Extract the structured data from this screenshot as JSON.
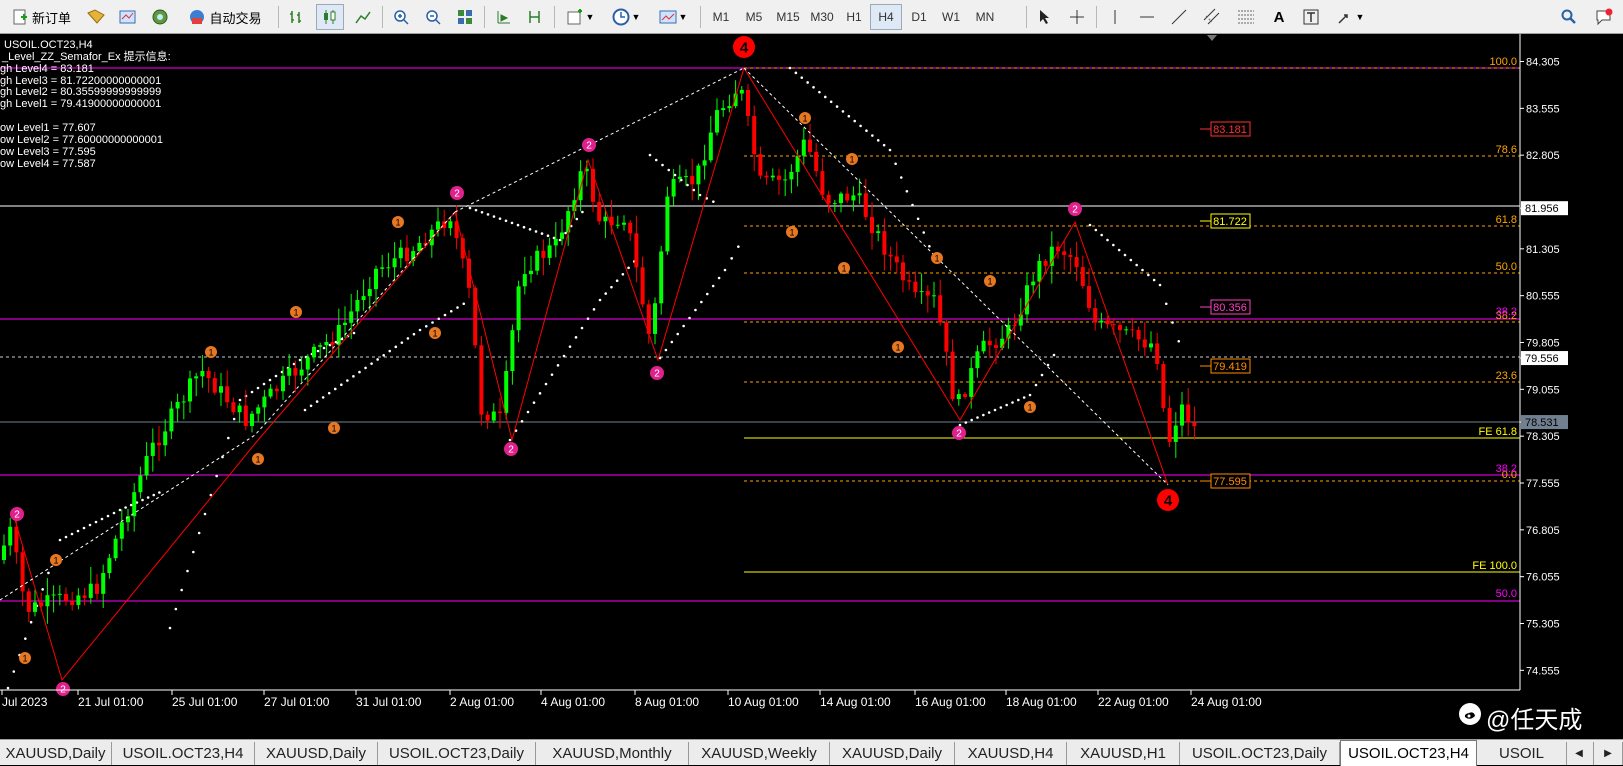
{
  "toolbar": {
    "new_order_label": "新订单",
    "auto_trade_label": "自动交易",
    "timeframes": [
      "M1",
      "M5",
      "M15",
      "M30",
      "H1",
      "H4",
      "D1",
      "W1",
      "MN"
    ],
    "active_timeframe": "H4"
  },
  "chart": {
    "symbol_title": "USOIL.OCT23,H4",
    "indicator_header": "_Level_ZZ_Semafor_Ex 提示信息:",
    "high_levels": [
      "gh Level4 = 83.181",
      "gh Level3 = 81.72200000000001",
      "gh Level2 = 80.35599999999999",
      "gh Level1 = 79.41900000000001"
    ],
    "low_levels": [
      "ow Level1 = 77.607",
      "ow Level2 = 77.60000000000001",
      "ow Level3 = 77.595",
      "ow Level4 = 77.587"
    ],
    "y_axis_ticks": [
      "84.305",
      "83.555",
      "82.805",
      "81.956",
      "81.305",
      "80.555",
      "79.805",
      "79.556",
      "79.055",
      "78.531",
      "78.305",
      "77.555",
      "76.805",
      "76.055",
      "75.305",
      "74.555"
    ],
    "x_axis_ticks": [
      "Jul 2023",
      "21 Jul 01:00",
      "25 Jul 01:00",
      "27 Jul 01:00",
      "31 Jul 01:00",
      "2 Aug 01:00",
      "4 Aug 01:00",
      "8 Aug 01:00",
      "10 Aug 01:00",
      "14 Aug 01:00",
      "16 Aug 01:00",
      "18 Aug 01:00",
      "22 Aug 01:00",
      "24 Aug 01:00"
    ],
    "fib_labels": [
      "100.0",
      "78.6",
      "61.8",
      "50.0",
      "38.2",
      "23.6",
      "0.0"
    ],
    "fe_labels": [
      "FE 61.8",
      "FE 100.0"
    ],
    "magenta_fib_labels": [
      "38.2",
      "50.0",
      "38.2"
    ],
    "price_boxes": [
      "83.181",
      "81.722",
      "80.356",
      "79.419",
      "77.595"
    ],
    "current_price": "78.531",
    "hline_price_white": "81.956",
    "hline_price_dotted": "79.556",
    "colors": {
      "bull": "#00ff00",
      "bear": "#ff0000",
      "zigzag": "#ff0000",
      "fib": "#ffa500",
      "fe": "#ffff00",
      "magenta": "#ff00ff",
      "marker_orange": "#e87722",
      "marker_pink": "#e0208c",
      "marker_red": "#ff0000"
    }
  },
  "tabs": [
    "XAUUSD,Daily",
    "USOIL.OCT23,H4",
    "XAUUSD,Daily",
    "USOIL.OCT23,Daily",
    "XAUUSD,Monthly",
    "XAUUSD,Weekly",
    "XAUUSD,Daily",
    "XAUUSD,H4",
    "XAUUSD,H1",
    "USOIL.OCT23,Daily",
    "USOIL.OCT23,H4",
    "USOIL"
  ],
  "active_tab_index": 10,
  "watermark": "@任天成"
}
